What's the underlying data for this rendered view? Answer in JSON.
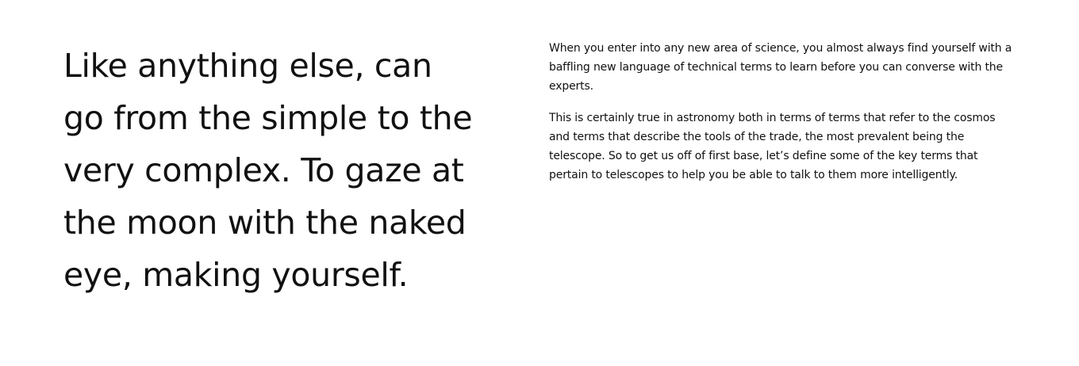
{
  "content": {
    "lead": "Like anything else, can go from the simple to the very complex. To gaze at the moon with the naked eye, making yourself.",
    "paragraphs": [
      "When you enter into any new area of science, you almost always find yourself with a baffling new language of technical terms to learn before you can converse with the experts.",
      "This is certainly true in astronomy both in terms of terms that refer to the cosmos and terms that describe the tools of the trade, the most prevalent being the telescope. So to get us off of first base, let’s define some of the key terms that pertain to telescopes to help you be able to talk to them more intelligently."
    ]
  }
}
